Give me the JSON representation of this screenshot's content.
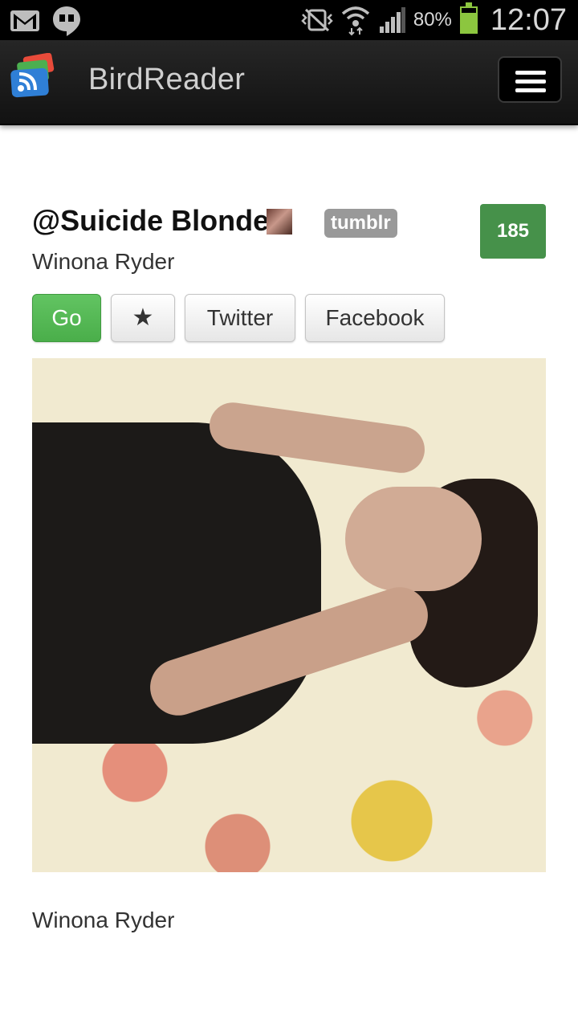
{
  "status_bar": {
    "battery_percent": "80%",
    "battery_level": 0.8,
    "time": "12:07",
    "icons": [
      "gmail-icon",
      "hangouts-icon",
      "vibrate-icon",
      "wifi-icon",
      "signal-icon",
      "battery-icon"
    ]
  },
  "action_bar": {
    "app_title": "BirdReader",
    "logo_icon": "rss-logo-icon",
    "menu_icon": "hamburger-menu-icon"
  },
  "post": {
    "handle": "@Suicide Blonde",
    "source_badge": "tumblr",
    "count": "185",
    "subtitle": "Winona Ryder",
    "buttons": {
      "go": "Go",
      "star": "★",
      "twitter": "Twitter",
      "facebook": "Facebook"
    },
    "caption": "Winona Ryder"
  },
  "colors": {
    "statusbar_bg": "#000000",
    "actionbar_bg": "#1a1a1a",
    "go_green": "#5cb85c",
    "count_green": "#46914a",
    "battery_green": "#8cc63f",
    "badge_gray": "#999999"
  }
}
